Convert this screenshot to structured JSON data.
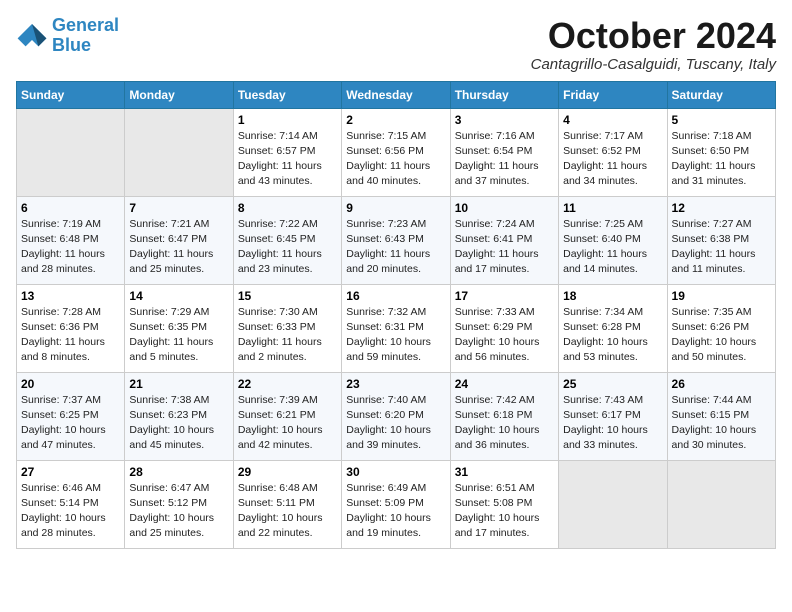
{
  "logo": {
    "line1": "General",
    "line2": "Blue"
  },
  "title": "October 2024",
  "location": "Cantagrillo-Casalguidi, Tuscany, Italy",
  "headers": [
    "Sunday",
    "Monday",
    "Tuesday",
    "Wednesday",
    "Thursday",
    "Friday",
    "Saturday"
  ],
  "weeks": [
    [
      {
        "day": "",
        "sunrise": "",
        "sunset": "",
        "daylight": ""
      },
      {
        "day": "",
        "sunrise": "",
        "sunset": "",
        "daylight": ""
      },
      {
        "day": "1",
        "sunrise": "Sunrise: 7:14 AM",
        "sunset": "Sunset: 6:57 PM",
        "daylight": "Daylight: 11 hours and 43 minutes."
      },
      {
        "day": "2",
        "sunrise": "Sunrise: 7:15 AM",
        "sunset": "Sunset: 6:56 PM",
        "daylight": "Daylight: 11 hours and 40 minutes."
      },
      {
        "day": "3",
        "sunrise": "Sunrise: 7:16 AM",
        "sunset": "Sunset: 6:54 PM",
        "daylight": "Daylight: 11 hours and 37 minutes."
      },
      {
        "day": "4",
        "sunrise": "Sunrise: 7:17 AM",
        "sunset": "Sunset: 6:52 PM",
        "daylight": "Daylight: 11 hours and 34 minutes."
      },
      {
        "day": "5",
        "sunrise": "Sunrise: 7:18 AM",
        "sunset": "Sunset: 6:50 PM",
        "daylight": "Daylight: 11 hours and 31 minutes."
      }
    ],
    [
      {
        "day": "6",
        "sunrise": "Sunrise: 7:19 AM",
        "sunset": "Sunset: 6:48 PM",
        "daylight": "Daylight: 11 hours and 28 minutes."
      },
      {
        "day": "7",
        "sunrise": "Sunrise: 7:21 AM",
        "sunset": "Sunset: 6:47 PM",
        "daylight": "Daylight: 11 hours and 25 minutes."
      },
      {
        "day": "8",
        "sunrise": "Sunrise: 7:22 AM",
        "sunset": "Sunset: 6:45 PM",
        "daylight": "Daylight: 11 hours and 23 minutes."
      },
      {
        "day": "9",
        "sunrise": "Sunrise: 7:23 AM",
        "sunset": "Sunset: 6:43 PM",
        "daylight": "Daylight: 11 hours and 20 minutes."
      },
      {
        "day": "10",
        "sunrise": "Sunrise: 7:24 AM",
        "sunset": "Sunset: 6:41 PM",
        "daylight": "Daylight: 11 hours and 17 minutes."
      },
      {
        "day": "11",
        "sunrise": "Sunrise: 7:25 AM",
        "sunset": "Sunset: 6:40 PM",
        "daylight": "Daylight: 11 hours and 14 minutes."
      },
      {
        "day": "12",
        "sunrise": "Sunrise: 7:27 AM",
        "sunset": "Sunset: 6:38 PM",
        "daylight": "Daylight: 11 hours and 11 minutes."
      }
    ],
    [
      {
        "day": "13",
        "sunrise": "Sunrise: 7:28 AM",
        "sunset": "Sunset: 6:36 PM",
        "daylight": "Daylight: 11 hours and 8 minutes."
      },
      {
        "day": "14",
        "sunrise": "Sunrise: 7:29 AM",
        "sunset": "Sunset: 6:35 PM",
        "daylight": "Daylight: 11 hours and 5 minutes."
      },
      {
        "day": "15",
        "sunrise": "Sunrise: 7:30 AM",
        "sunset": "Sunset: 6:33 PM",
        "daylight": "Daylight: 11 hours and 2 minutes."
      },
      {
        "day": "16",
        "sunrise": "Sunrise: 7:32 AM",
        "sunset": "Sunset: 6:31 PM",
        "daylight": "Daylight: 10 hours and 59 minutes."
      },
      {
        "day": "17",
        "sunrise": "Sunrise: 7:33 AM",
        "sunset": "Sunset: 6:29 PM",
        "daylight": "Daylight: 10 hours and 56 minutes."
      },
      {
        "day": "18",
        "sunrise": "Sunrise: 7:34 AM",
        "sunset": "Sunset: 6:28 PM",
        "daylight": "Daylight: 10 hours and 53 minutes."
      },
      {
        "day": "19",
        "sunrise": "Sunrise: 7:35 AM",
        "sunset": "Sunset: 6:26 PM",
        "daylight": "Daylight: 10 hours and 50 minutes."
      }
    ],
    [
      {
        "day": "20",
        "sunrise": "Sunrise: 7:37 AM",
        "sunset": "Sunset: 6:25 PM",
        "daylight": "Daylight: 10 hours and 47 minutes."
      },
      {
        "day": "21",
        "sunrise": "Sunrise: 7:38 AM",
        "sunset": "Sunset: 6:23 PM",
        "daylight": "Daylight: 10 hours and 45 minutes."
      },
      {
        "day": "22",
        "sunrise": "Sunrise: 7:39 AM",
        "sunset": "Sunset: 6:21 PM",
        "daylight": "Daylight: 10 hours and 42 minutes."
      },
      {
        "day": "23",
        "sunrise": "Sunrise: 7:40 AM",
        "sunset": "Sunset: 6:20 PM",
        "daylight": "Daylight: 10 hours and 39 minutes."
      },
      {
        "day": "24",
        "sunrise": "Sunrise: 7:42 AM",
        "sunset": "Sunset: 6:18 PM",
        "daylight": "Daylight: 10 hours and 36 minutes."
      },
      {
        "day": "25",
        "sunrise": "Sunrise: 7:43 AM",
        "sunset": "Sunset: 6:17 PM",
        "daylight": "Daylight: 10 hours and 33 minutes."
      },
      {
        "day": "26",
        "sunrise": "Sunrise: 7:44 AM",
        "sunset": "Sunset: 6:15 PM",
        "daylight": "Daylight: 10 hours and 30 minutes."
      }
    ],
    [
      {
        "day": "27",
        "sunrise": "Sunrise: 6:46 AM",
        "sunset": "Sunset: 5:14 PM",
        "daylight": "Daylight: 10 hours and 28 minutes."
      },
      {
        "day": "28",
        "sunrise": "Sunrise: 6:47 AM",
        "sunset": "Sunset: 5:12 PM",
        "daylight": "Daylight: 10 hours and 25 minutes."
      },
      {
        "day": "29",
        "sunrise": "Sunrise: 6:48 AM",
        "sunset": "Sunset: 5:11 PM",
        "daylight": "Daylight: 10 hours and 22 minutes."
      },
      {
        "day": "30",
        "sunrise": "Sunrise: 6:49 AM",
        "sunset": "Sunset: 5:09 PM",
        "daylight": "Daylight: 10 hours and 19 minutes."
      },
      {
        "day": "31",
        "sunrise": "Sunrise: 6:51 AM",
        "sunset": "Sunset: 5:08 PM",
        "daylight": "Daylight: 10 hours and 17 minutes."
      },
      {
        "day": "",
        "sunrise": "",
        "sunset": "",
        "daylight": ""
      },
      {
        "day": "",
        "sunrise": "",
        "sunset": "",
        "daylight": ""
      }
    ]
  ]
}
